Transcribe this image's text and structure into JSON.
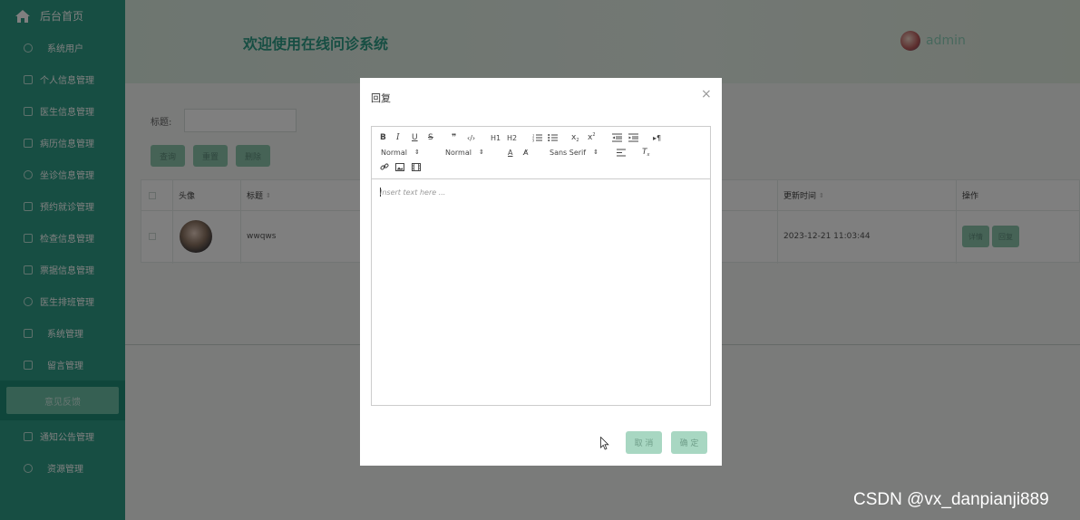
{
  "sidebar": {
    "home_label": "后台首页",
    "items": [
      {
        "label": "系统用户",
        "icon": "shield-icon"
      },
      {
        "label": "个人信息管理",
        "icon": "edit-icon"
      },
      {
        "label": "医生信息管理",
        "icon": "edit-icon"
      },
      {
        "label": "病历信息管理",
        "icon": "edit-icon"
      },
      {
        "label": "坐诊信息管理",
        "icon": "shield-icon"
      },
      {
        "label": "预约就诊管理",
        "icon": "edit-icon"
      },
      {
        "label": "检查信息管理",
        "icon": "edit-icon"
      },
      {
        "label": "票据信息管理",
        "icon": "edit-icon"
      },
      {
        "label": "医生排班管理",
        "icon": "shield-icon"
      },
      {
        "label": "系统管理",
        "icon": "edit-icon"
      },
      {
        "label": "留言管理",
        "icon": "edit-icon"
      }
    ],
    "submenu_label": "意见反馈",
    "items_after": [
      {
        "label": "通知公告管理",
        "icon": "edit-icon"
      },
      {
        "label": "资源管理",
        "icon": "shield-icon"
      }
    ]
  },
  "header": {
    "title": "欢迎使用在线问诊系统",
    "username": "admin"
  },
  "main": {
    "filter_label": "标题:",
    "filter_value": "",
    "buttons": {
      "query": "查询",
      "reset": "重置",
      "delete": "删除"
    },
    "table": {
      "headers": {
        "avatar": "头像",
        "title": "标题",
        "updated": "更新时间",
        "actions": "操作"
      },
      "rows": [
        {
          "title": "wwqws",
          "updated": "2023-12-21 11:03:44",
          "detail": "详情",
          "reply": "回复"
        }
      ]
    }
  },
  "modal": {
    "title": "回复",
    "close": "×",
    "editor": {
      "placeholder": "Insert text here ...",
      "size_select": "Normal",
      "header_select": "Normal",
      "font_select": "Sans Serif",
      "h1": "H1",
      "h2": "H2"
    },
    "cancel": "取 消",
    "confirm": "确 定"
  },
  "watermark": "CSDN @vx_danpianji889"
}
